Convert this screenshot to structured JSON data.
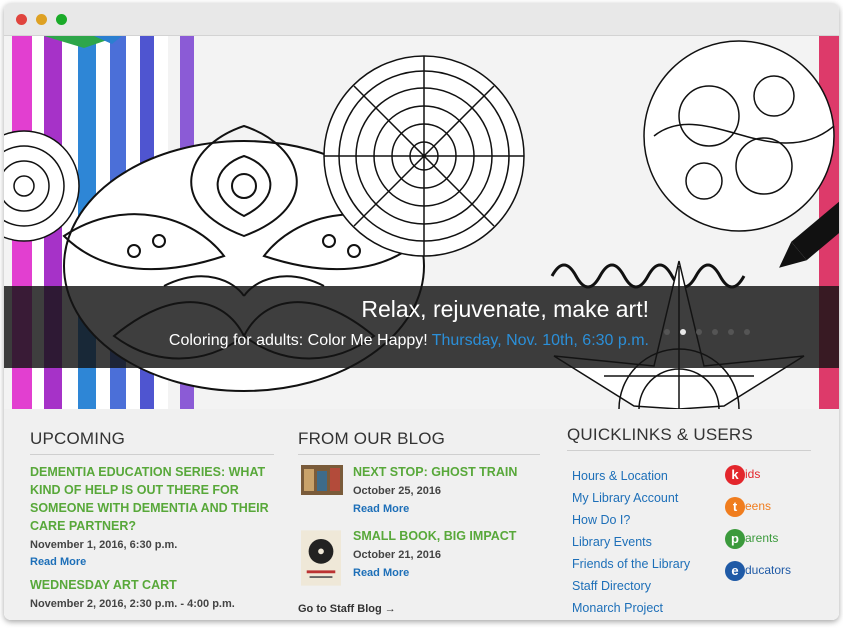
{
  "hero": {
    "title": "Relax, rejuvenate, make art!",
    "subtitle": "Coloring for adults: Color Me Happy!",
    "date": "Thursday, Nov. 10th, 6:30 p.m.",
    "slides": 6,
    "active_slide": 1
  },
  "upcoming": {
    "heading": "UPCOMING",
    "events": [
      {
        "title": "DEMENTIA EDUCATION SERIES: WHAT KIND OF HELP IS OUT THERE FOR SOMEONE WITH DEMENTIA AND THEIR CARE PARTNER?",
        "date": "November 1, 2016, 6:30 p.m.",
        "more": "Read More"
      },
      {
        "title": "WEDNESDAY ART CART",
        "date": "November 2, 2016, 2:30 p.m. - 4:00 p.m."
      }
    ]
  },
  "blog": {
    "heading": "FROM OUR BLOG",
    "posts": [
      {
        "title": "NEXT STOP: GHOST TRAIN",
        "date": "October 25, 2016",
        "more": "Read More"
      },
      {
        "title": "SMALL BOOK, BIG IMPACT",
        "date": "October 21, 2016",
        "more": "Read More"
      }
    ],
    "staff_link": "Go to Staff Blog →"
  },
  "quicklinks": {
    "heading": "QUICKLINKS & USERS",
    "links": [
      "Hours & Location",
      "My Library Account",
      "How Do I?",
      "Library Events",
      "Friends of the Library",
      "Staff Directory",
      "Monarch Project"
    ],
    "users": [
      {
        "letter": "k",
        "label": "ids",
        "color": "#e3262c"
      },
      {
        "letter": "t",
        "label": "eens",
        "color": "#f07d1e"
      },
      {
        "letter": "p",
        "label": "arents",
        "color": "#3b9a3c"
      },
      {
        "letter": "e",
        "label": "ducators",
        "color": "#1f5aa6"
      }
    ]
  },
  "colors": {
    "green": "#58a83a",
    "blue": "#1d6fb8",
    "caption_date": "#2b8fd8"
  }
}
